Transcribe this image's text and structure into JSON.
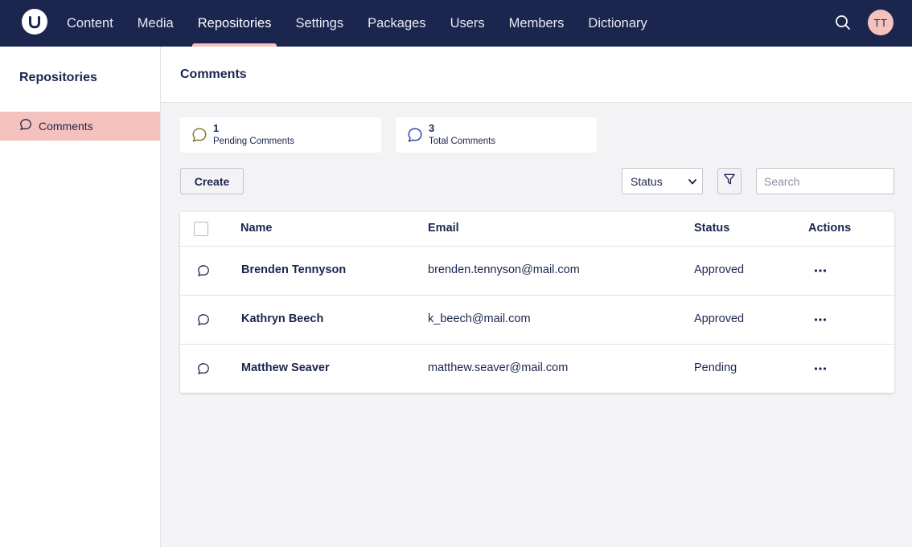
{
  "header": {
    "logo_icon": "umbraco-logo-icon",
    "nav": [
      {
        "label": "Content",
        "active": false
      },
      {
        "label": "Media",
        "active": false
      },
      {
        "label": "Repositories",
        "active": true
      },
      {
        "label": "Settings",
        "active": false
      },
      {
        "label": "Packages",
        "active": false
      },
      {
        "label": "Users",
        "active": false
      },
      {
        "label": "Members",
        "active": false
      },
      {
        "label": "Dictionary",
        "active": false
      }
    ],
    "search_icon": "search-icon",
    "avatar_initials": "TT"
  },
  "sidebar": {
    "title": "Repositories",
    "items": [
      {
        "label": "Comments",
        "icon": "comment-icon",
        "selected": true
      }
    ]
  },
  "main": {
    "title": "Comments",
    "stats": [
      {
        "value": "1",
        "label": "Pending Comments",
        "icon": "comment-icon",
        "icon_color": "#8a7a2a"
      },
      {
        "value": "3",
        "label": "Total Comments",
        "icon": "comment-icon",
        "icon_color": "#3544b1"
      }
    ],
    "toolbar": {
      "create_label": "Create",
      "status_select_value": "Status",
      "filter_icon": "filter-icon",
      "search_placeholder": "Search"
    },
    "table": {
      "columns": [
        "Name",
        "Email",
        "Status",
        "Actions"
      ],
      "rows": [
        {
          "name": "Brenden Tennyson",
          "email": "brenden.tennyson@mail.com",
          "status": "Approved"
        },
        {
          "name": "Kathryn Beech",
          "email": "k_beech@mail.com",
          "status": "Approved"
        },
        {
          "name": "Matthew Seaver",
          "email": "matthew.seaver@mail.com",
          "status": "Pending"
        }
      ]
    }
  },
  "colors": {
    "header_bg": "#1b264f",
    "accent": "#f5c1bc",
    "text": "#1b264f",
    "page_bg": "#f3f3f5"
  }
}
